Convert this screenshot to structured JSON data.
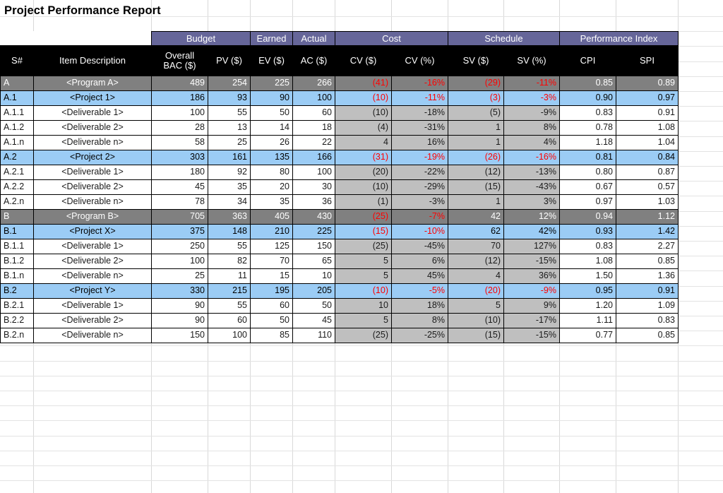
{
  "page": {
    "title": "Project Performance Report"
  },
  "table": {
    "group_headers": [
      {
        "label": "",
        "span": 2,
        "blank": true
      },
      {
        "label": "Budget",
        "span": 2
      },
      {
        "label": "Earned",
        "span": 1
      },
      {
        "label": "Actual",
        "span": 1
      },
      {
        "label": "Cost",
        "span": 2
      },
      {
        "label": "Schedule",
        "span": 2
      },
      {
        "label": "Performance Index",
        "span": 2
      }
    ],
    "columns": [
      "S#",
      "Item Description",
      "Overall\nBAC ($)",
      "PV ($)",
      "EV ($)",
      "AC ($)",
      "CV ($)",
      "CV (%)",
      "SV ($)",
      "SV (%)",
      "CPI",
      "SPI"
    ],
    "column_labels": {
      "sn": "S#",
      "desc": "Item Description",
      "bac_line1": "Overall",
      "bac_line2": "BAC ($)",
      "pv": "PV ($)",
      "ev": "EV ($)",
      "ac": "AC ($)",
      "cv_dollar": "CV ($)",
      "cv_pct": "CV (%)",
      "sv_dollar": "SV ($)",
      "sv_pct": "SV (%)",
      "cpi": "CPI",
      "spi": "SPI"
    },
    "rows": [
      {
        "level": "program",
        "sn": "A",
        "desc": "<Program A>",
        "bac": "489",
        "pv": "254",
        "ev": "225",
        "ac": "266",
        "cv": "(41)",
        "cv_pct": "-16%",
        "sv": "(29)",
        "sv_pct": "-11%",
        "cpi": "0.85",
        "spi": "0.89",
        "cv_neg": true,
        "cv_pct_neg": true,
        "sv_neg": true,
        "sv_pct_neg": true
      },
      {
        "level": "project",
        "sn": "A.1",
        "desc": "<Project 1>",
        "bac": "186",
        "pv": "93",
        "ev": "90",
        "ac": "100",
        "cv": "(10)",
        "cv_pct": "-11%",
        "sv": "(3)",
        "sv_pct": "-3%",
        "cpi": "0.90",
        "spi": "0.97",
        "cv_neg": true,
        "cv_pct_neg": true,
        "sv_neg": true,
        "sv_pct_neg": true
      },
      {
        "level": "deliverable",
        "sn": "A.1.1",
        "desc": "<Deliverable 1>",
        "bac": "100",
        "pv": "55",
        "ev": "50",
        "ac": "60",
        "cv": "(10)",
        "cv_pct": "-18%",
        "sv": "(5)",
        "sv_pct": "-9%",
        "cpi": "0.83",
        "spi": "0.91",
        "cv_neg": true,
        "cv_pct_neg": true,
        "sv_neg": true,
        "sv_pct_neg": true
      },
      {
        "level": "deliverable",
        "sn": "A.1.2",
        "desc": "<Deliverable 2>",
        "bac": "28",
        "pv": "13",
        "ev": "14",
        "ac": "18",
        "cv": "(4)",
        "cv_pct": "-31%",
        "sv": "1",
        "sv_pct": "8%",
        "cpi": "0.78",
        "spi": "1.08",
        "cv_neg": true,
        "cv_pct_neg": true,
        "sv_neg": false,
        "sv_pct_neg": false
      },
      {
        "level": "deliverable",
        "sn": "A.1.n",
        "desc": "<Deliverable n>",
        "bac": "58",
        "pv": "25",
        "ev": "26",
        "ac": "22",
        "cv": "4",
        "cv_pct": "16%",
        "sv": "1",
        "sv_pct": "4%",
        "cpi": "1.18",
        "spi": "1.04",
        "cv_neg": false,
        "cv_pct_neg": false,
        "sv_neg": false,
        "sv_pct_neg": false
      },
      {
        "level": "project",
        "sn": "A.2",
        "desc": "<Project 2>",
        "bac": "303",
        "pv": "161",
        "ev": "135",
        "ac": "166",
        "cv": "(31)",
        "cv_pct": "-19%",
        "sv": "(26)",
        "sv_pct": "-16%",
        "cpi": "0.81",
        "spi": "0.84",
        "cv_neg": true,
        "cv_pct_neg": true,
        "sv_neg": true,
        "sv_pct_neg": true
      },
      {
        "level": "deliverable",
        "sn": "A.2.1",
        "desc": "<Deliverable 1>",
        "bac": "180",
        "pv": "92",
        "ev": "80",
        "ac": "100",
        "cv": "(20)",
        "cv_pct": "-22%",
        "sv": "(12)",
        "sv_pct": "-13%",
        "cpi": "0.80",
        "spi": "0.87",
        "cv_neg": true,
        "cv_pct_neg": true,
        "sv_neg": true,
        "sv_pct_neg": true
      },
      {
        "level": "deliverable",
        "sn": "A.2.2",
        "desc": "<Deliverable 2>",
        "bac": "45",
        "pv": "35",
        "ev": "20",
        "ac": "30",
        "cv": "(10)",
        "cv_pct": "-29%",
        "sv": "(15)",
        "sv_pct": "-43%",
        "cpi": "0.67",
        "spi": "0.57",
        "cv_neg": true,
        "cv_pct_neg": true,
        "sv_neg": true,
        "sv_pct_neg": true
      },
      {
        "level": "deliverable",
        "sn": "A.2.n",
        "desc": "<Deliverable n>",
        "bac": "78",
        "pv": "34",
        "ev": "35",
        "ac": "36",
        "cv": "(1)",
        "cv_pct": "-3%",
        "sv": "1",
        "sv_pct": "3%",
        "cpi": "0.97",
        "spi": "1.03",
        "cv_neg": true,
        "cv_pct_neg": true,
        "sv_neg": false,
        "sv_pct_neg": false
      },
      {
        "level": "program",
        "sn": "B",
        "desc": "<Program B>",
        "bac": "705",
        "pv": "363",
        "ev": "405",
        "ac": "430",
        "cv": "(25)",
        "cv_pct": "-7%",
        "sv": "42",
        "sv_pct": "12%",
        "cpi": "0.94",
        "spi": "1.12",
        "cv_neg": true,
        "cv_pct_neg": true,
        "sv_neg": false,
        "sv_pct_neg": false
      },
      {
        "level": "project",
        "sn": "B.1",
        "desc": "<Project X>",
        "bac": "375",
        "pv": "148",
        "ev": "210",
        "ac": "225",
        "cv": "(15)",
        "cv_pct": "-10%",
        "sv": "62",
        "sv_pct": "42%",
        "cpi": "0.93",
        "spi": "1.42",
        "cv_neg": true,
        "cv_pct_neg": true,
        "sv_neg": false,
        "sv_pct_neg": false
      },
      {
        "level": "deliverable",
        "sn": "B.1.1",
        "desc": "<Deliverable 1>",
        "bac": "250",
        "pv": "55",
        "ev": "125",
        "ac": "150",
        "cv": "(25)",
        "cv_pct": "-45%",
        "sv": "70",
        "sv_pct": "127%",
        "cpi": "0.83",
        "spi": "2.27",
        "cv_neg": true,
        "cv_pct_neg": true,
        "sv_neg": false,
        "sv_pct_neg": false
      },
      {
        "level": "deliverable",
        "sn": "B.1.2",
        "desc": "<Deliverable 2>",
        "bac": "100",
        "pv": "82",
        "ev": "70",
        "ac": "65",
        "cv": "5",
        "cv_pct": "6%",
        "sv": "(12)",
        "sv_pct": "-15%",
        "cpi": "1.08",
        "spi": "0.85",
        "cv_neg": false,
        "cv_pct_neg": false,
        "sv_neg": true,
        "sv_pct_neg": true
      },
      {
        "level": "deliverable",
        "sn": "B.1.n",
        "desc": "<Deliverable n>",
        "bac": "25",
        "pv": "11",
        "ev": "15",
        "ac": "10",
        "cv": "5",
        "cv_pct": "45%",
        "sv": "4",
        "sv_pct": "36%",
        "cpi": "1.50",
        "spi": "1.36",
        "cv_neg": false,
        "cv_pct_neg": false,
        "sv_neg": false,
        "sv_pct_neg": false
      },
      {
        "level": "project",
        "sn": "B.2",
        "desc": "<Project Y>",
        "bac": "330",
        "pv": "215",
        "ev": "195",
        "ac": "205",
        "cv": "(10)",
        "cv_pct": "-5%",
        "sv": "(20)",
        "sv_pct": "-9%",
        "cpi": "0.95",
        "spi": "0.91",
        "cv_neg": true,
        "cv_pct_neg": true,
        "sv_neg": true,
        "sv_pct_neg": true
      },
      {
        "level": "deliverable",
        "sn": "B.2.1",
        "desc": "<Deliverable 1>",
        "bac": "90",
        "pv": "55",
        "ev": "60",
        "ac": "50",
        "cv": "10",
        "cv_pct": "18%",
        "sv": "5",
        "sv_pct": "9%",
        "cpi": "1.20",
        "spi": "1.09",
        "cv_neg": false,
        "cv_pct_neg": false,
        "sv_neg": false,
        "sv_pct_neg": false
      },
      {
        "level": "deliverable",
        "sn": "B.2.2",
        "desc": "<Deliverable 2>",
        "bac": "90",
        "pv": "60",
        "ev": "50",
        "ac": "45",
        "cv": "5",
        "cv_pct": "8%",
        "sv": "(10)",
        "sv_pct": "-17%",
        "cpi": "1.11",
        "spi": "0.83",
        "cv_neg": false,
        "cv_pct_neg": false,
        "sv_neg": true,
        "sv_pct_neg": true
      },
      {
        "level": "deliverable",
        "sn": "B.2.n",
        "desc": "<Deliverable n>",
        "bac": "150",
        "pv": "100",
        "ev": "85",
        "ac": "110",
        "cv": "(25)",
        "cv_pct": "-25%",
        "sv": "(15)",
        "sv_pct": "-15%",
        "cpi": "0.77",
        "spi": "0.85",
        "cv_neg": true,
        "cv_pct_neg": true,
        "sv_neg": true,
        "sv_pct_neg": true
      }
    ]
  },
  "colors": {
    "group_header_purple": "#666699",
    "column_header_black": "#000000",
    "program_row_gray": "#808080",
    "project_row_blue": "#9BCCF5",
    "variance_cell_gray": "#BFBFBF",
    "negative_red": "#FF0000",
    "sheet_gridline": "#D9D9D9"
  }
}
